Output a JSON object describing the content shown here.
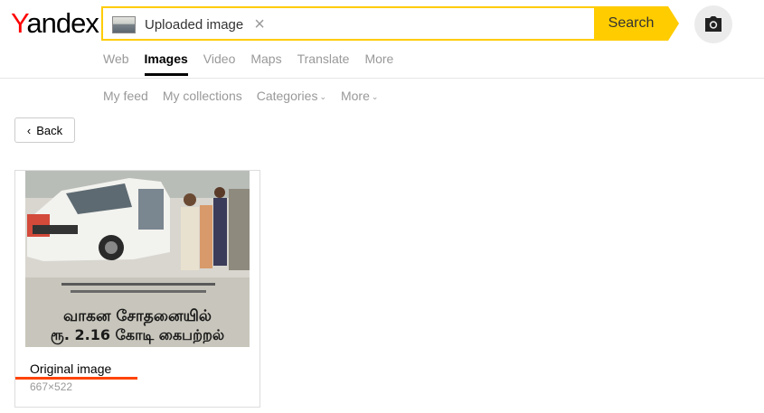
{
  "logo": {
    "first": "Y",
    "rest": "andex"
  },
  "search": {
    "chip_label": "Uploaded image",
    "close_glyph": "×",
    "button_label": "Search"
  },
  "tabs": [
    {
      "label": "Web",
      "active": false
    },
    {
      "label": "Images",
      "active": true
    },
    {
      "label": "Video",
      "active": false
    },
    {
      "label": "Maps",
      "active": false
    },
    {
      "label": "Translate",
      "active": false
    },
    {
      "label": "More",
      "active": false
    }
  ],
  "subnav": {
    "feed": "My feed",
    "collections": "My collections",
    "categories": "Categories",
    "more": "More"
  },
  "back": {
    "label": "Back"
  },
  "result": {
    "caption": "Original image",
    "dimensions": "667×522",
    "photo_text_line1": "வாகன சோதனையில்",
    "photo_text_line2": "ரூ. 2.16 கோடி கைபற்றல்"
  },
  "colors": {
    "accent": "#ffcc00",
    "logo_red": "#ff0000",
    "underline": "#ff4400"
  }
}
